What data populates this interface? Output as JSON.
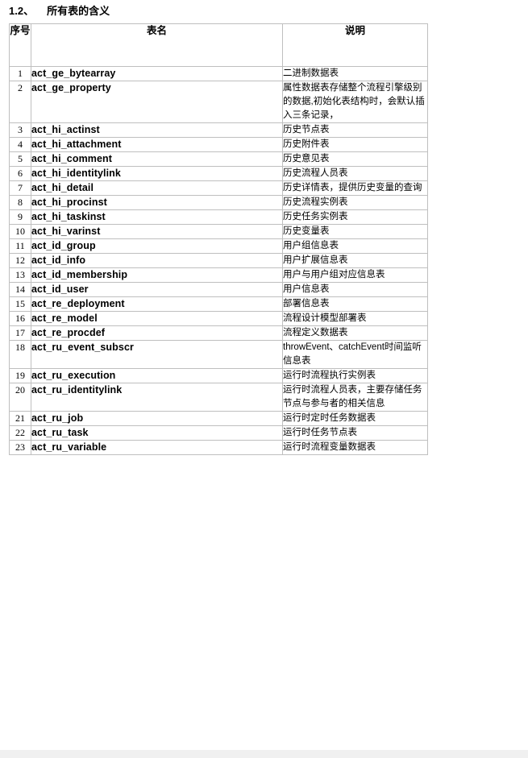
{
  "document": {
    "heading_number": "1.2、",
    "heading_title": "所有表的含义"
  },
  "table": {
    "columns": [
      {
        "key": "no",
        "label": "序号"
      },
      {
        "key": "name",
        "label": "表名"
      },
      {
        "key": "desc",
        "label": "说明"
      }
    ],
    "rows": [
      {
        "no": "1",
        "name": "act_ge_bytearray",
        "desc": "二进制数据表"
      },
      {
        "no": "2",
        "name": "act_ge_property",
        "desc": "属性数据表存储整个流程引擎级别的数据,初始化表结构时，会默认插入三条记录，"
      },
      {
        "no": "3",
        "name": "act_hi_actinst",
        "desc": "历史节点表"
      },
      {
        "no": "4",
        "name": "act_hi_attachment",
        "desc": "历史附件表"
      },
      {
        "no": "5",
        "name": "act_hi_comment",
        "desc": "历史意见表"
      },
      {
        "no": "6",
        "name": "act_hi_identitylink",
        "desc": "历史流程人员表"
      },
      {
        "no": "7",
        "name": "act_hi_detail",
        "desc": "历史详情表，提供历史变量的查询"
      },
      {
        "no": "8",
        "name": "act_hi_procinst",
        "desc": "历史流程实例表"
      },
      {
        "no": "9",
        "name": "act_hi_taskinst",
        "desc": "历史任务实例表"
      },
      {
        "no": "10",
        "name": "act_hi_varinst",
        "desc": "历史变量表"
      },
      {
        "no": "11",
        "name": "act_id_group",
        "desc": "用户组信息表"
      },
      {
        "no": "12",
        "name": "act_id_info",
        "desc": "用户扩展信息表"
      },
      {
        "no": "13",
        "name": "act_id_membership",
        "desc": "用户与用户组对应信息表"
      },
      {
        "no": "14",
        "name": "act_id_user",
        "desc": "用户信息表"
      },
      {
        "no": "15",
        "name": "act_re_deployment",
        "desc": "部署信息表"
      },
      {
        "no": "16",
        "name": "act_re_model",
        "desc": "流程设计模型部署表"
      },
      {
        "no": "17",
        "name": "act_re_procdef",
        "desc": "流程定义数据表"
      },
      {
        "no": "18",
        "name": "act_ru_event_subscr",
        "desc": "throwEvent、catchEvent时间监听信息表"
      },
      {
        "no": "19",
        "name": "act_ru_execution",
        "desc": "运行时流程执行实例表"
      },
      {
        "no": "20",
        "name": "act_ru_identitylink",
        "desc": "运行时流程人员表，主要存储任务节点与参与者的相关信息"
      },
      {
        "no": "21",
        "name": "act_ru_job",
        "desc": "运行时定时任务数据表"
      },
      {
        "no": "22",
        "name": "act_ru_task",
        "desc": "运行时任务节点表"
      },
      {
        "no": "23",
        "name": "act_ru_variable",
        "desc": "运行时流程变量数据表"
      }
    ]
  },
  "style": {
    "border_color": "#bfbfbf",
    "page_background": "#ffffff",
    "outer_background": "#f0f0f0",
    "text_color": "#000000"
  }
}
